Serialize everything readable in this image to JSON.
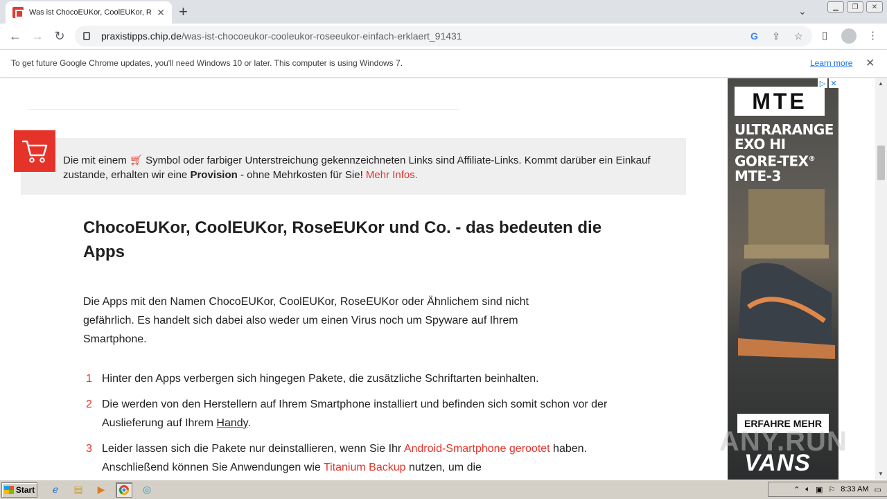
{
  "browser": {
    "tab_title": "Was ist ChocoEUKor, CoolEUKor, Ro",
    "url_host": "praxistipps.chip.de",
    "url_path": "/was-ist-chocoeukor-cooleukor-roseeukor-einfach-erklaert_91431"
  },
  "infobar": {
    "message": "To get future Google Chrome updates, you'll need Windows 10 or later. This computer is using Windows 7.",
    "link": "Learn more"
  },
  "affiliate": {
    "part1": "Die mit einem ",
    "part2": " Symbol oder farbiger Unterstreichung gekennzeichneten Links sind Affiliate-Links. Kommt darüber ein Einkauf zustande, erhalten wir eine ",
    "bold": "Provision",
    "part3": " - ohne Mehrkosten für Sie! ",
    "link": "Mehr Infos."
  },
  "article": {
    "heading": "ChocoEUKor, CoolEUKor, RoseEUKor und Co. - das bedeuten die Apps",
    "intro": "Die Apps mit den Namen ChocoEUKor, CoolEUKor, RoseEUKor oder Ähnlichem sind nicht gefährlich. Es handelt sich dabei also weder um einen Virus noch um Spyware auf Ihrem Smartphone.",
    "list": [
      {
        "num": "1",
        "text": "Hinter den Apps verbergen sich hingegen Pakete, die zusätzliche Schriftarten beinhalten."
      },
      {
        "num": "2",
        "pre": "Die werden von den Herstellern auf Ihrem Smartphone installiert und befinden sich somit schon vor der Auslieferung auf Ihrem ",
        "link": "Handy",
        "post": "."
      },
      {
        "num": "3",
        "pre": "Leider lassen sich die Pakete nur deinstallieren, wenn Sie Ihr ",
        "link": "Android-Smartphone gerootet",
        "mid": " haben. Anschließend können Sie Anwendungen wie ",
        "link2": "Titanium Backup",
        "post": " nutzen, um die"
      }
    ]
  },
  "ad": {
    "logo": "MTE",
    "tagline_lines": [
      "ULTRARANGE",
      "EXO HI",
      "GORE-TEX",
      "MTE-3"
    ],
    "tagline_mark": "®",
    "button": "ERFAHRE MEHR",
    "brand": "VANS",
    "choices_play": "▷",
    "choices_close": "✕"
  },
  "watermark": "ANY.RUN",
  "taskbar": {
    "start": "Start",
    "clock": "8:33 AM"
  },
  "colors": {
    "accent": "#e6332a",
    "link_blue": "#1a73e8"
  }
}
